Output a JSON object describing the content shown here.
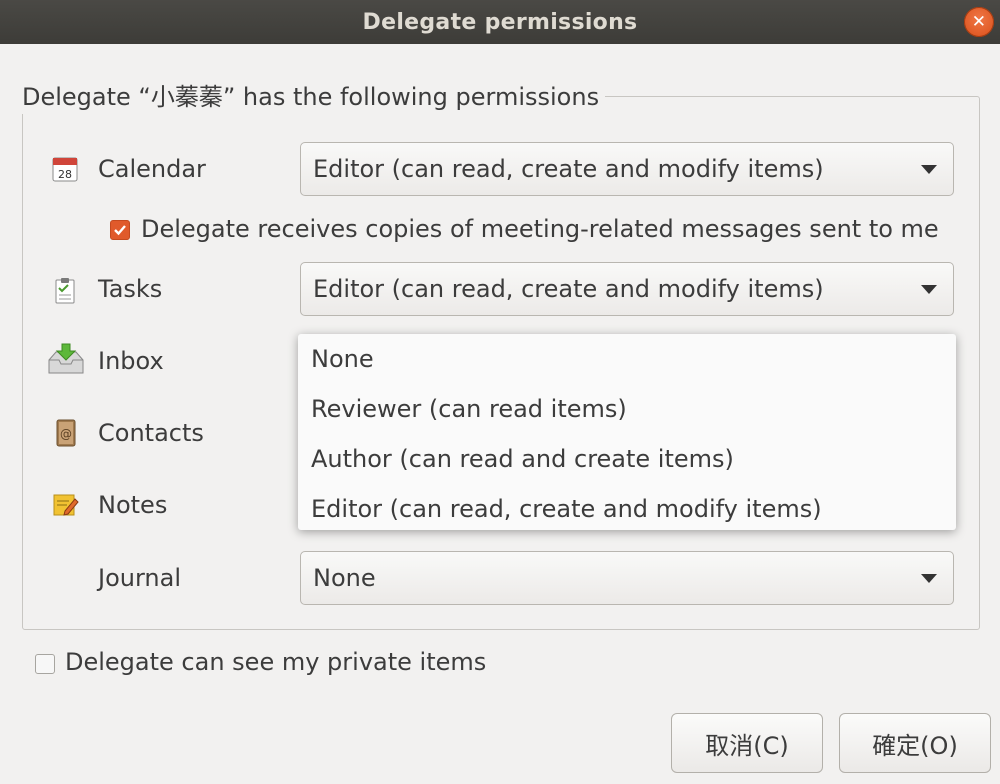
{
  "window": {
    "title": "Delegate permissions"
  },
  "group": {
    "legend": "Delegate “小蓁蓁” has the following permissions"
  },
  "rows": {
    "calendar": {
      "label": "Calendar",
      "value": "Editor (can read, create and modify items)",
      "icon": "calendar-icon"
    },
    "tasks": {
      "label": "Tasks",
      "value": "Editor (can read, create and modify items)",
      "icon": "tasks-icon"
    },
    "inbox": {
      "label": "Inbox",
      "icon": "inbox-icon"
    },
    "contacts": {
      "label": "Contacts",
      "icon": "contacts-icon"
    },
    "notes": {
      "label": "Notes",
      "icon": "notes-icon"
    },
    "journal": {
      "label": "Journal",
      "value": "None"
    }
  },
  "meeting_copies": {
    "label": "Delegate receives copies of meeting-related messages sent to me",
    "checked": true
  },
  "dropdown_options": [
    "None",
    "Reviewer (can read items)",
    "Author (can read and create items)",
    "Editor (can read, create and modify items)"
  ],
  "private_items": {
    "label": "Delegate can see my private items",
    "checked": false
  },
  "buttons": {
    "cancel": "取消(C)",
    "ok": "確定(O)"
  },
  "calendar_icon_day": "28",
  "colors": {
    "accent": "#e05a2b",
    "titlebar": "#3d3c38"
  }
}
